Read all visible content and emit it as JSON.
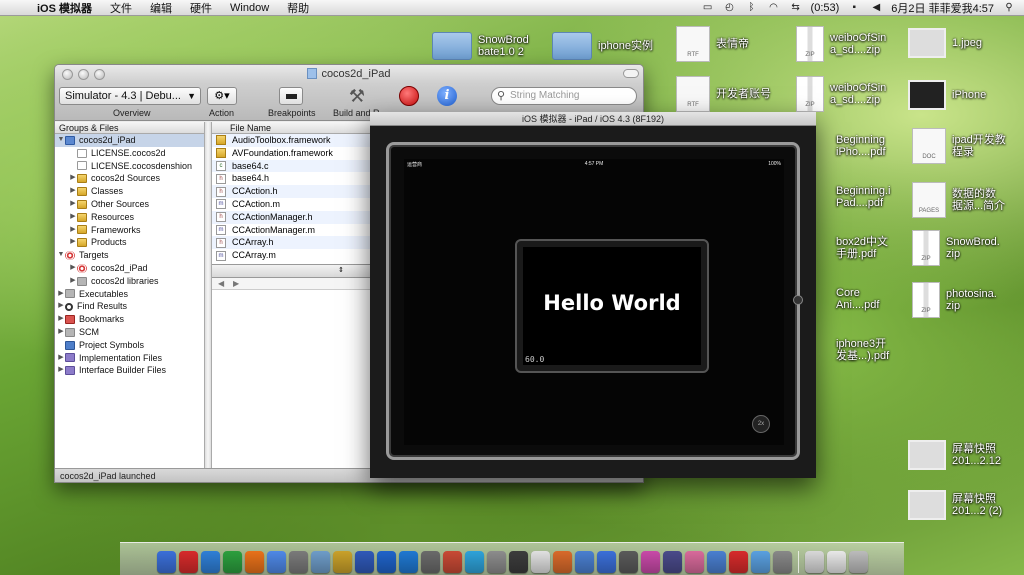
{
  "menubar": {
    "app": "iOS 模拟器",
    "items": [
      "文件",
      "编辑",
      "硬件",
      "Window",
      "帮助"
    ],
    "battery": "(0:53)",
    "clock": "6月2日 菲菲爱我4:57"
  },
  "desktop": {
    "icons": [
      {
        "label": "SnowBrod\nbate1.0 2",
        "kind": "folder"
      },
      {
        "label": "iphone实例",
        "kind": "folder"
      },
      {
        "label": "表情帝",
        "kind": "rtf",
        "badge": "RTF"
      },
      {
        "label": "weiboOfSin\na_sd....zip",
        "kind": "zip",
        "badge": "ZIP"
      },
      {
        "label": "1.jpeg",
        "kind": "thumb"
      },
      {
        "label": "开发者账号",
        "kind": "rtf",
        "badge": "RTF"
      },
      {
        "label": "weiboOfSin\na_sd....zip",
        "kind": "zip",
        "badge": "ZIP"
      },
      {
        "label": "iPhone",
        "kind": "thumb"
      },
      {
        "label": "Beginning\niPho....pdf",
        "kind": "doc"
      },
      {
        "label": "ipad开发教\n程录",
        "kind": "doc",
        "badge": "DOC"
      },
      {
        "label": "Beginning.i\nPad....pdf",
        "kind": "doc"
      },
      {
        "label": "数据的数\n据源...简介",
        "kind": "doc",
        "badge": "PAGES"
      },
      {
        "label": "box2d中文\n手册.pdf",
        "kind": "doc"
      },
      {
        "label": "SnowBrod.\nzip",
        "kind": "zip",
        "badge": "ZIP"
      },
      {
        "label": "Core\nAni....pdf",
        "kind": "doc"
      },
      {
        "label": "photosina.\nzip",
        "kind": "zip",
        "badge": "ZIP"
      },
      {
        "label": "iphone3开\n发基...).pdf",
        "kind": "doc"
      },
      {
        "label": "屏幕快照\n201...2.12",
        "kind": "thumb-light"
      },
      {
        "label": "屏幕快照\n201...2 (2)",
        "kind": "thumb-light"
      }
    ]
  },
  "xcode": {
    "title": "cocos2d_iPad",
    "toolbar": {
      "scheme": "Simulator - 4.3 | Debu...",
      "labels": {
        "overview": "Overview",
        "action": "Action",
        "breakpoints": "Breakpoints",
        "build": "Build and R"
      },
      "search_placeholder": "String Matching"
    },
    "groups_header": "Groups & Files",
    "files_header": "File Name",
    "groups": [
      {
        "label": "cocos2d_iPad",
        "indent": 0,
        "tri": "▼",
        "icon": "proj",
        "selected": true
      },
      {
        "label": "LICENSE.cocos2d",
        "indent": 1,
        "tri": "",
        "icon": "doc"
      },
      {
        "label": "LICENSE.cocosdenshion",
        "indent": 1,
        "tri": "",
        "icon": "doc"
      },
      {
        "label": "cocos2d Sources",
        "indent": 1,
        "tri": "▶",
        "icon": "folder"
      },
      {
        "label": "Classes",
        "indent": 1,
        "tri": "▶",
        "icon": "folder"
      },
      {
        "label": "Other Sources",
        "indent": 1,
        "tri": "▶",
        "icon": "folder"
      },
      {
        "label": "Resources",
        "indent": 1,
        "tri": "▶",
        "icon": "folder"
      },
      {
        "label": "Frameworks",
        "indent": 1,
        "tri": "▶",
        "icon": "folder"
      },
      {
        "label": "Products",
        "indent": 1,
        "tri": "▶",
        "icon": "folder"
      },
      {
        "label": "Targets",
        "indent": 0,
        "tri": "▼",
        "icon": "target"
      },
      {
        "label": "cocos2d_iPad",
        "indent": 1,
        "tri": "▶",
        "icon": "target"
      },
      {
        "label": "cocos2d libraries",
        "indent": 1,
        "tri": "▶",
        "icon": "gray"
      },
      {
        "label": "Executables",
        "indent": 0,
        "tri": "▶",
        "icon": "gray"
      },
      {
        "label": "Find Results",
        "indent": 0,
        "tri": "▶",
        "icon": "mag"
      },
      {
        "label": "Bookmarks",
        "indent": 0,
        "tri": "▶",
        "icon": "book"
      },
      {
        "label": "SCM",
        "indent": 0,
        "tri": "▶",
        "icon": "gray"
      },
      {
        "label": "Project Symbols",
        "indent": 0,
        "tri": "",
        "icon": "blue"
      },
      {
        "label": "Implementation Files",
        "indent": 0,
        "tri": "▶",
        "icon": "purple"
      },
      {
        "label": "Interface Builder Files",
        "indent": 0,
        "tri": "▶",
        "icon": "purple"
      }
    ],
    "files": [
      {
        "name": "AudioToolbox.framework",
        "type": "fw"
      },
      {
        "name": "AVFoundation.framework",
        "type": "fw"
      },
      {
        "name": "base64.c",
        "type": "c"
      },
      {
        "name": "base64.h",
        "type": "h"
      },
      {
        "name": "CCAction.h",
        "type": "h"
      },
      {
        "name": "CCAction.m",
        "type": "m"
      },
      {
        "name": "CCActionManager.h",
        "type": "h"
      },
      {
        "name": "CCActionManager.m",
        "type": "m"
      },
      {
        "name": "CCArray.h",
        "type": "h"
      },
      {
        "name": "CCArray.m",
        "type": "m"
      }
    ],
    "status": "cocos2d_iPad launched"
  },
  "simulator": {
    "title": "iOS 模拟器 - iPad / iOS 4.3 (8F192)",
    "carrier": "运营商",
    "time": "4:57 PM",
    "battery": "100%",
    "hello": "Hello World",
    "fps": "60.0",
    "zoom": "2x"
  },
  "dock": {
    "colors": [
      "#3b6fd8",
      "#d62b2b",
      "#2f7fd6",
      "#2c9f3e",
      "#e8711a",
      "#4e88e6",
      "#7a7a7a",
      "#6e9cc8",
      "#c9a12a",
      "#2f59b8",
      "#1f63c9",
      "#1f78d1",
      "#6a6a6a",
      "#c84a35",
      "#2ea2d9",
      "#8c8c8c",
      "#3c3c3c",
      "#e0e0e0",
      "#d86a2b",
      "#4a7fd0",
      "#3b6fd8",
      "#5a5a5a",
      "#c84aa8",
      "#4a4a8a",
      "#d86a9b",
      "#4a7fd0",
      "#d62b2b",
      "#5aa0e0",
      "#888888",
      "#d8d8d8",
      "#e8e8e8",
      "#bbbbbb"
    ]
  }
}
